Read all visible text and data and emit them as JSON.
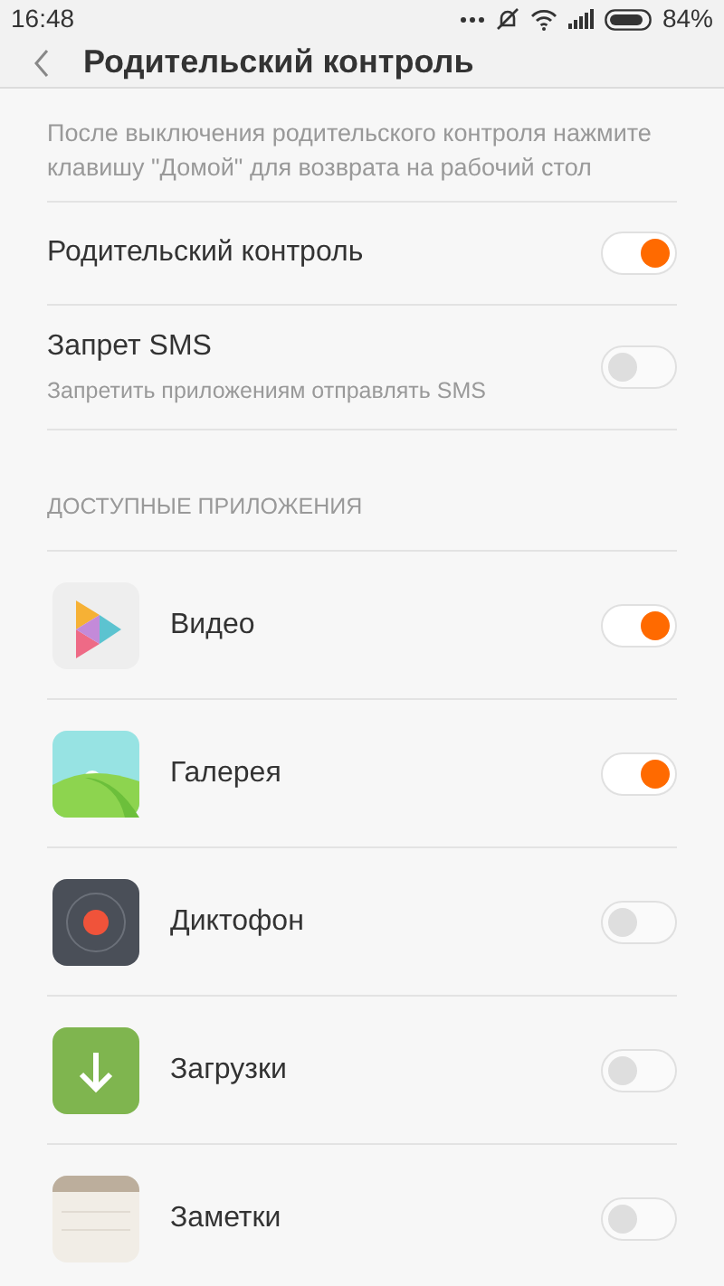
{
  "status_bar": {
    "time": "16:48",
    "battery": "84%"
  },
  "header": {
    "title": "Родительский контроль"
  },
  "note": "После выключения родительского контроля нажмите клавишу \"Домой\" для возврата на рабочий стол",
  "settings": [
    {
      "label": "Родительский контроль",
      "on": true
    },
    {
      "label": "Запрет SMS",
      "description": "Запретить приложениям отправлять SMS",
      "on": false
    }
  ],
  "section_title": "ДОСТУПНЫЕ ПРИЛОЖЕНИЯ",
  "apps": [
    {
      "kind": "video",
      "name": "Видео",
      "on": true
    },
    {
      "kind": "gallery",
      "name": "Галерея",
      "on": true
    },
    {
      "kind": "recorder",
      "name": "Диктофон",
      "on": false
    },
    {
      "kind": "downloads",
      "name": "Загрузки",
      "on": false
    },
    {
      "kind": "notes",
      "name": "Заметки",
      "on": false
    }
  ]
}
